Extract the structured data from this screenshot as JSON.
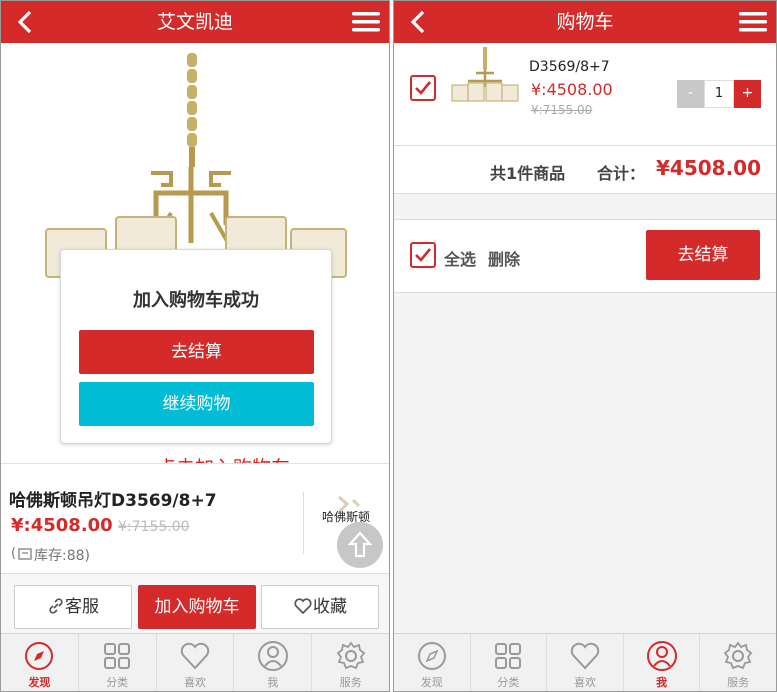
{
  "left": {
    "header": {
      "title": "艾文凯迪"
    },
    "dialog": {
      "title": "加入购物车成功",
      "checkout_label": "去结算",
      "continue_label": "继续购物"
    },
    "annotation": "点击加入购物车",
    "product": {
      "name": "哈佛斯顿吊灯D3569/8+7",
      "price": "¥:4508.00",
      "old_price": "¥:7155.00",
      "stock": "库存:88"
    },
    "side_thumb_label": "哈佛斯顿",
    "actions": {
      "service_label": "客服",
      "add_cart_label": "加入购物车",
      "favorite_label": "收藏"
    },
    "tabs": [
      {
        "label": "发现",
        "icon": "compass-icon"
      },
      {
        "label": "分类",
        "icon": "grid-icon"
      },
      {
        "label": "喜欢",
        "icon": "heart-icon"
      },
      {
        "label": "我",
        "icon": "user-icon"
      },
      {
        "label": "服务",
        "icon": "gear-icon"
      }
    ],
    "active_tab": "发现"
  },
  "right": {
    "header": {
      "title": "购物车"
    },
    "item": {
      "model": "D3569/8+7",
      "price": "¥:4508.00",
      "old_price": "¥:7155.00",
      "quantity": "1",
      "minus": "-",
      "plus": "+"
    },
    "summary": {
      "count_text": "共1件商品",
      "total_label": "合计：",
      "total_value": "¥4508.00"
    },
    "footer": {
      "select_all_label": "全选",
      "delete_label": "删除",
      "checkout_label": "去结算"
    },
    "tabs": [
      {
        "label": "发现",
        "icon": "compass-icon"
      },
      {
        "label": "分类",
        "icon": "grid-icon"
      },
      {
        "label": "喜欢",
        "icon": "heart-icon"
      },
      {
        "label": "我",
        "icon": "user-icon"
      },
      {
        "label": "服务",
        "icon": "gear-icon"
      }
    ],
    "active_tab": "我"
  },
  "colors": {
    "brand_red": "#d42a2a",
    "cyan": "#00bcd4"
  }
}
